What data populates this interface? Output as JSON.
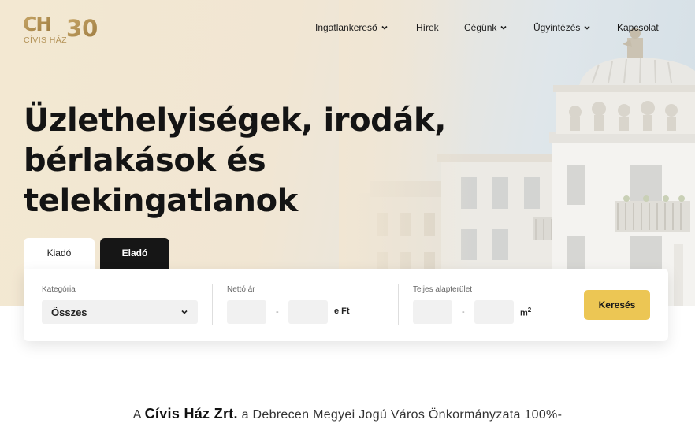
{
  "logo": {
    "mark": "CH",
    "number": "30",
    "name": "CÍVIS HÁZ",
    "color": "#b39256"
  },
  "nav": {
    "items": [
      {
        "label": "Ingatlankereső",
        "has_dropdown": true
      },
      {
        "label": "Hírek",
        "has_dropdown": false
      },
      {
        "label": "Cégünk",
        "has_dropdown": true
      },
      {
        "label": "Ügyintézés",
        "has_dropdown": true
      },
      {
        "label": "Kapcsolat",
        "has_dropdown": false
      }
    ]
  },
  "hero": {
    "headline_lines": [
      "Üzlethelyiségek, irodák,",
      "bérlakások és",
      "telekingatlanok"
    ]
  },
  "tabs": [
    {
      "label": "Kiadó",
      "active": true
    },
    {
      "label": "Eladó",
      "active": false
    }
  ],
  "search": {
    "category_label": "Kategória",
    "category_value": "Összes",
    "price_label": "Nettó ár",
    "price_unit": "e Ft",
    "area_label": "Teljes alapterület",
    "area_unit": "m",
    "area_unit_sup": "2",
    "range_separator": "-",
    "button_label": "Keresés",
    "button_color": "#ecc654"
  },
  "intro": {
    "prefix": "A",
    "company": "Cívis Ház Zrt.",
    "rest": "a Debrecen Megyei Jogú Város Önkormányzata 100%-"
  }
}
